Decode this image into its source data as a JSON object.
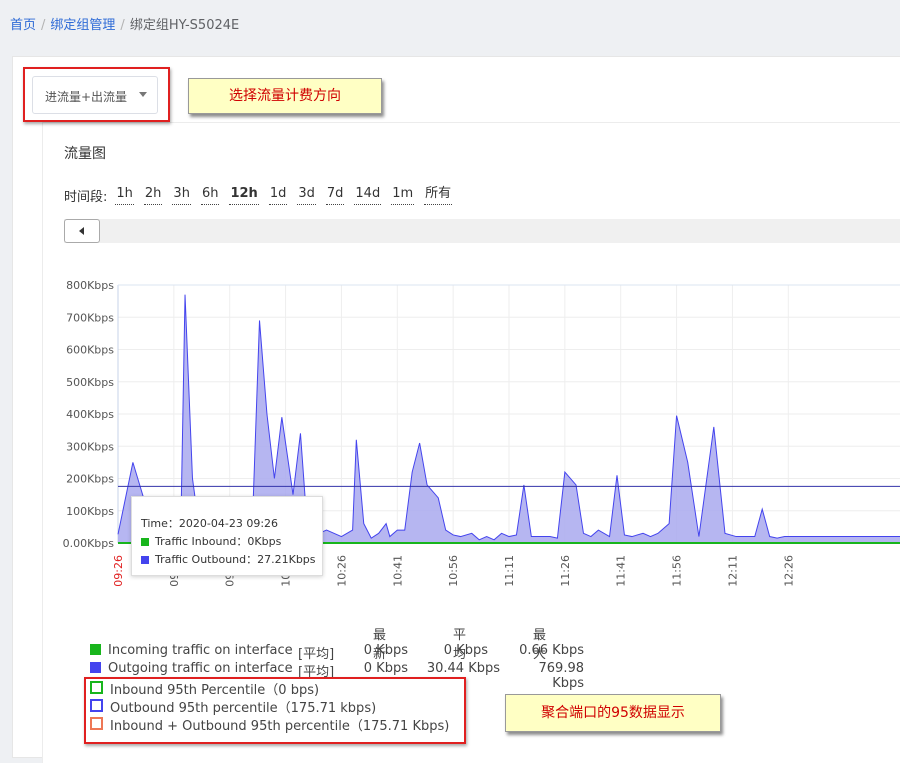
{
  "breadcrumb": {
    "items": [
      {
        "label": "首页"
      },
      {
        "label": "绑定组管理"
      },
      {
        "label": "绑定组HY-S5024E"
      }
    ]
  },
  "billing_select": {
    "value": "进流量+出流量"
  },
  "annotations": {
    "select_note": "选择流量计费方向",
    "percentile_note": "聚合端口的95数据显示"
  },
  "traffic": {
    "title": "流量图",
    "period_label": "时间段:",
    "periods": [
      "1h",
      "2h",
      "3h",
      "6h",
      "12h",
      "1d",
      "3d",
      "7d",
      "14d",
      "1m",
      "所有"
    ],
    "active_period": "12h"
  },
  "tooltip": {
    "time": "Time：2020-04-23 09:26",
    "inbound": "Traffic Inbound：0Kbps",
    "outbound": "Traffic Outbound：27.21Kbps"
  },
  "legend": {
    "headers": [
      "最新",
      "平均",
      "最大"
    ],
    "rows": [
      {
        "label": "Incoming traffic on interface",
        "agg": "[平均]",
        "latest": "0 Kbps",
        "avg": "0 Kbps",
        "max": "0.66 Kbps"
      },
      {
        "label": "Outgoing traffic on interface",
        "agg": "[平均]",
        "latest": "0 Kbps",
        "avg": "30.44 Kbps",
        "max": "769.98 Kbps"
      }
    ],
    "percentiles": [
      "Inbound 95th Percentile（0 bps)",
      "Outbound 95th percentile（175.71 kbps)",
      "Inbound + Outbound 95th percentile（175.71 Kbps)"
    ]
  },
  "colors": {
    "inbound": "#18b51c",
    "outbound": "#4444ee",
    "outbound_fill": "#a9a9ee",
    "percentile_line": "#3333aa",
    "combined_box": "#ee7755",
    "highlight": "#e02020",
    "note_bg": "#ffffc4",
    "note_text": "#d00000"
  },
  "chart_data": {
    "type": "area",
    "ylabel_ticks": [
      "0.00Kbps",
      "100Kbps",
      "200Kbps",
      "300Kbps",
      "400Kbps",
      "500Kbps",
      "600Kbps",
      "700Kbps",
      "800Kbps"
    ],
    "ylim": [
      0,
      800
    ],
    "x_ticks": [
      "09:26",
      "09:41",
      "09:56",
      "10:11",
      "10:26",
      "10:41",
      "10:56",
      "11:11",
      "11:26",
      "11:41",
      "11:56",
      "12:11",
      "12:26"
    ],
    "x_minutes": [
      0,
      4,
      10,
      12,
      14,
      17,
      18,
      20,
      22,
      24,
      26,
      28,
      30,
      33,
      36,
      38,
      40,
      42,
      44,
      47,
      49,
      51,
      52,
      54,
      56,
      58,
      60,
      63,
      64,
      66,
      68,
      70,
      72,
      73,
      75,
      77,
      79,
      81,
      83,
      86,
      88,
      90,
      92,
      95,
      97,
      99,
      100,
      101,
      103,
      105,
      107,
      109,
      111,
      114,
      116,
      118,
      120,
      123,
      125,
      127,
      129,
      132,
      134,
      136,
      138,
      141,
      143,
      145,
      146,
      148,
      150,
      153,
      156,
      160,
      163,
      166,
      169,
      171,
      173,
      175,
      177,
      179,
      181,
      184,
      187,
      189,
      191,
      193,
      195,
      197,
      200,
      204,
      210
    ],
    "grid": true,
    "percentile_value_kbps": 175.71,
    "series": [
      {
        "name": "Incoming traffic on interface",
        "values": [
          0,
          0,
          0,
          0,
          0,
          0,
          0,
          0,
          0,
          0,
          0,
          0,
          0,
          0,
          0,
          0,
          0,
          0,
          0,
          0,
          0,
          0,
          0,
          0,
          0,
          0,
          0,
          0,
          0,
          0,
          0,
          0,
          0,
          0,
          0,
          0,
          0,
          0,
          0,
          0,
          0,
          0,
          0,
          0,
          0,
          0,
          0,
          0,
          0,
          0,
          0,
          0,
          0,
          0,
          0,
          0,
          0,
          0,
          0,
          0,
          0,
          0,
          0,
          0,
          0,
          0,
          0,
          0,
          0,
          0,
          0,
          0,
          0,
          0,
          0,
          0,
          0,
          0,
          0,
          0,
          0,
          0,
          0,
          0,
          0,
          0,
          0,
          0,
          0,
          0,
          0,
          0,
          0
        ]
      },
      {
        "name": "Outgoing traffic on interface",
        "values": [
          27,
          250,
          20,
          30,
          40,
          130,
          770,
          200,
          30,
          20,
          40,
          60,
          40,
          30,
          30,
          690,
          400,
          200,
          390,
          150,
          340,
          20,
          100,
          30,
          40,
          30,
          20,
          40,
          320,
          60,
          15,
          30,
          60,
          20,
          40,
          40,
          220,
          310,
          180,
          140,
          40,
          25,
          20,
          30,
          10,
          20,
          15,
          10,
          30,
          20,
          25,
          180,
          20,
          20,
          20,
          15,
          220,
          180,
          30,
          20,
          40,
          20,
          210,
          25,
          20,
          30,
          20,
          30,
          40,
          60,
          395,
          250,
          20,
          360,
          30,
          20,
          20,
          20,
          105,
          20,
          15,
          20,
          20,
          20,
          20,
          20,
          20,
          20,
          20,
          20,
          20,
          20,
          20
        ]
      }
    ]
  }
}
